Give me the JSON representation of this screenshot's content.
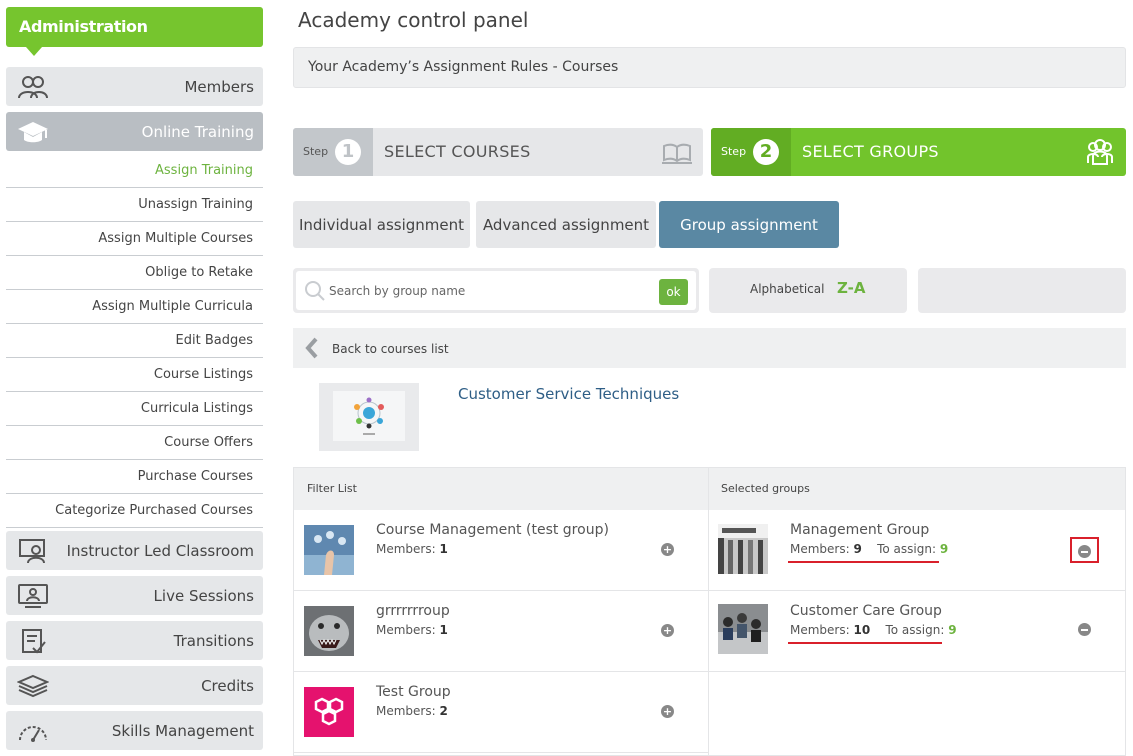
{
  "sidebar": {
    "header": "Administration",
    "nav_top": [
      {
        "label": "Members",
        "icon": "members-icon"
      },
      {
        "label": "Online Training",
        "icon": "graduation-cap-icon",
        "active": true
      }
    ],
    "sub_items": [
      {
        "label": "Assign Training",
        "active": true
      },
      {
        "label": "Unassign Training"
      },
      {
        "label": "Assign Multiple Courses"
      },
      {
        "label": "Oblige to Retake"
      },
      {
        "label": "Assign Multiple Curricula"
      },
      {
        "label": "Edit Badges"
      },
      {
        "label": "Course Listings"
      },
      {
        "label": "Curricula Listings"
      },
      {
        "label": "Course Offers"
      },
      {
        "label": "Purchase Courses"
      },
      {
        "label": "Categorize Purchased Courses"
      }
    ],
    "nav_bottom": [
      {
        "label": "Instructor Led Classroom",
        "icon": "classroom-icon"
      },
      {
        "label": "Live Sessions",
        "icon": "live-session-icon"
      },
      {
        "label": "Transitions",
        "icon": "transitions-icon"
      },
      {
        "label": "Credits",
        "icon": "credits-icon"
      },
      {
        "label": "Skills Management",
        "icon": "gauge-icon"
      }
    ]
  },
  "main": {
    "title": "Academy control panel",
    "rules_bar": "Your Academy’s Assignment Rules - Courses",
    "steps": [
      {
        "step_label": "Step",
        "number": "1",
        "title": "SELECT COURSES",
        "icon": "open-book-icon"
      },
      {
        "step_label": "Step",
        "number": "2",
        "title": "SELECT GROUPS",
        "icon": "group-icon",
        "active": true
      }
    ],
    "tabs": [
      {
        "label": "Individual assignment"
      },
      {
        "label": "Advanced assignment"
      },
      {
        "label": "Group assignment",
        "active": true
      }
    ],
    "search": {
      "placeholder": "Search by group name",
      "value": "",
      "ok_label": "ok"
    },
    "sort": {
      "label": "Alphabetical",
      "order": "Z-A"
    },
    "back_label": "Back to courses list",
    "course": {
      "title": "Customer Service Techniques"
    },
    "filter_list": {
      "header": "Filter List",
      "groups": [
        {
          "name": "Course Management (test group)",
          "members_label": "Members:",
          "members": "1"
        },
        {
          "name": "grrrrrrroup",
          "members_label": "Members:",
          "members": "1"
        },
        {
          "name": "Test Group",
          "members_label": "Members:",
          "members": "2"
        }
      ]
    },
    "selected_groups": {
      "header": "Selected groups",
      "groups": [
        {
          "name": "Management Group",
          "members_label": "Members:",
          "members": "9",
          "assign_label": "To assign:",
          "to_assign": "9"
        },
        {
          "name": "Customer Care Group",
          "members_label": "Members:",
          "members": "10",
          "assign_label": "To assign:",
          "to_assign": "9"
        }
      ]
    }
  },
  "colors": {
    "accent_green": "#76c52e",
    "tab_active": "#5a88a3",
    "highlight_red": "#d9202b",
    "link_blue": "#2e5e86"
  }
}
